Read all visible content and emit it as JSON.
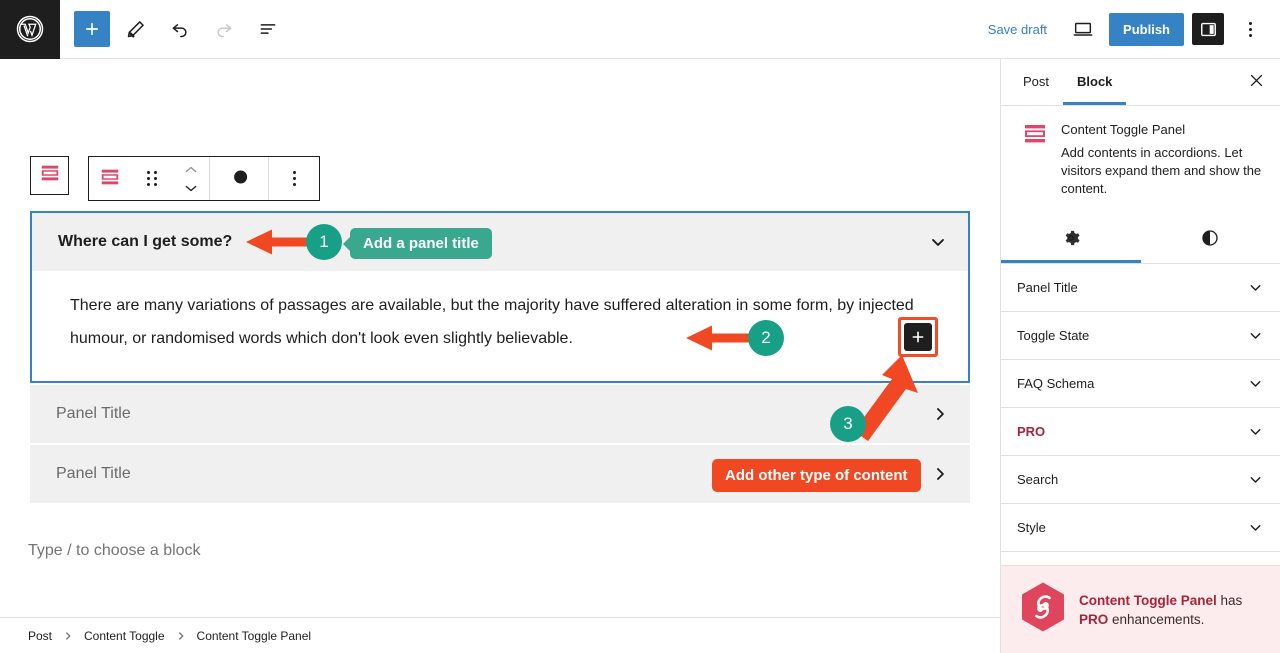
{
  "topbar": {
    "logo_icon": "wordpress-logo-icon",
    "add_block_icon": "plus-icon",
    "tools_icon": "pencil-edit-icon",
    "undo_icon": "undo-arrow-icon",
    "redo_icon": "redo-arrow-icon",
    "list_view_icon": "list-view-icon",
    "save_draft_label": "Save draft",
    "preview_icon": "desktop-preview-icon",
    "publish_label": "Publish",
    "sidebar_toggle_icon": "sidebar-panel-icon",
    "options_icon": "three-dots-vertical-icon"
  },
  "block_toolbar": {
    "parent_selector_icon": "content-toggle-parent-icon",
    "block_type_icon": "content-toggle-panel-icon",
    "drag_handle_icon": "drag-handle-dots-icon",
    "move_up_icon": "chevron-up-icon",
    "move_down_icon": "chevron-down-icon",
    "duotone_icon": "duotone-contrast-icon",
    "more_options_icon": "three-dots-vertical-icon"
  },
  "editor": {
    "panels": [
      {
        "title": "Where can I get some?",
        "is_placeholder": false,
        "expanded": true,
        "chevron_icon": "chevron-down-icon",
        "content": "There are many variations of passages are available, but the majority have suffered alteration in some form, by injected humour, or randomised words which don't look even slightly believable."
      },
      {
        "title": "Panel Title",
        "is_placeholder": true,
        "expanded": false,
        "chevron_icon": "chevron-right-icon"
      },
      {
        "title": "Panel Title",
        "is_placeholder": true,
        "expanded": false,
        "chevron_icon": "chevron-right-icon"
      }
    ],
    "inserter_icon": "plus-icon",
    "block_placeholder": "Type / to choose a block"
  },
  "annotations": {
    "accent_teal": "#17a085",
    "accent_teal_label": "#3aa88f",
    "accent_red": "#ef4823",
    "items": [
      {
        "number": "1",
        "label": "Add a panel title",
        "style": "teal"
      },
      {
        "number": "2",
        "label": "",
        "style": "teal"
      },
      {
        "number": "3",
        "label": "Add other type of content",
        "style": "red"
      }
    ]
  },
  "sidebar": {
    "tabs": [
      {
        "label": "Post",
        "active": false
      },
      {
        "label": "Block",
        "active": true
      }
    ],
    "close_icon": "close-x-icon",
    "block_card": {
      "icon": "content-toggle-panel-icon",
      "title": "Content Toggle Panel",
      "description": "Add contents in accordions. Let visitors expand them and show the content."
    },
    "icon_tabs": [
      {
        "icon": "settings-gear-icon",
        "active": true
      },
      {
        "icon": "styles-contrast-icon",
        "active": false
      }
    ],
    "panel_rows": [
      {
        "label": "Panel Title",
        "pro": false,
        "chevron_icon": "chevron-down-icon"
      },
      {
        "label": "Toggle State",
        "pro": false,
        "chevron_icon": "chevron-down-icon"
      },
      {
        "label": "FAQ Schema",
        "pro": false,
        "chevron_icon": "chevron-down-icon"
      },
      {
        "label": "PRO",
        "pro": true,
        "chevron_icon": "chevron-down-icon"
      },
      {
        "label": "Search",
        "pro": false,
        "chevron_icon": "chevron-down-icon"
      },
      {
        "label": "Style",
        "pro": false,
        "chevron_icon": "chevron-down-icon"
      }
    ],
    "pro_banner": {
      "logo_icon": "pro-hexagon-logo-icon",
      "strong_text": "Content Toggle Panel",
      "mid_text": " has ",
      "pro_text": "PRO",
      "end_text": " enhancements."
    }
  },
  "breadcrumb": {
    "items": [
      "Post",
      "Content Toggle",
      "Content Toggle Panel"
    ],
    "separator_icon": "chevron-right-icon"
  }
}
